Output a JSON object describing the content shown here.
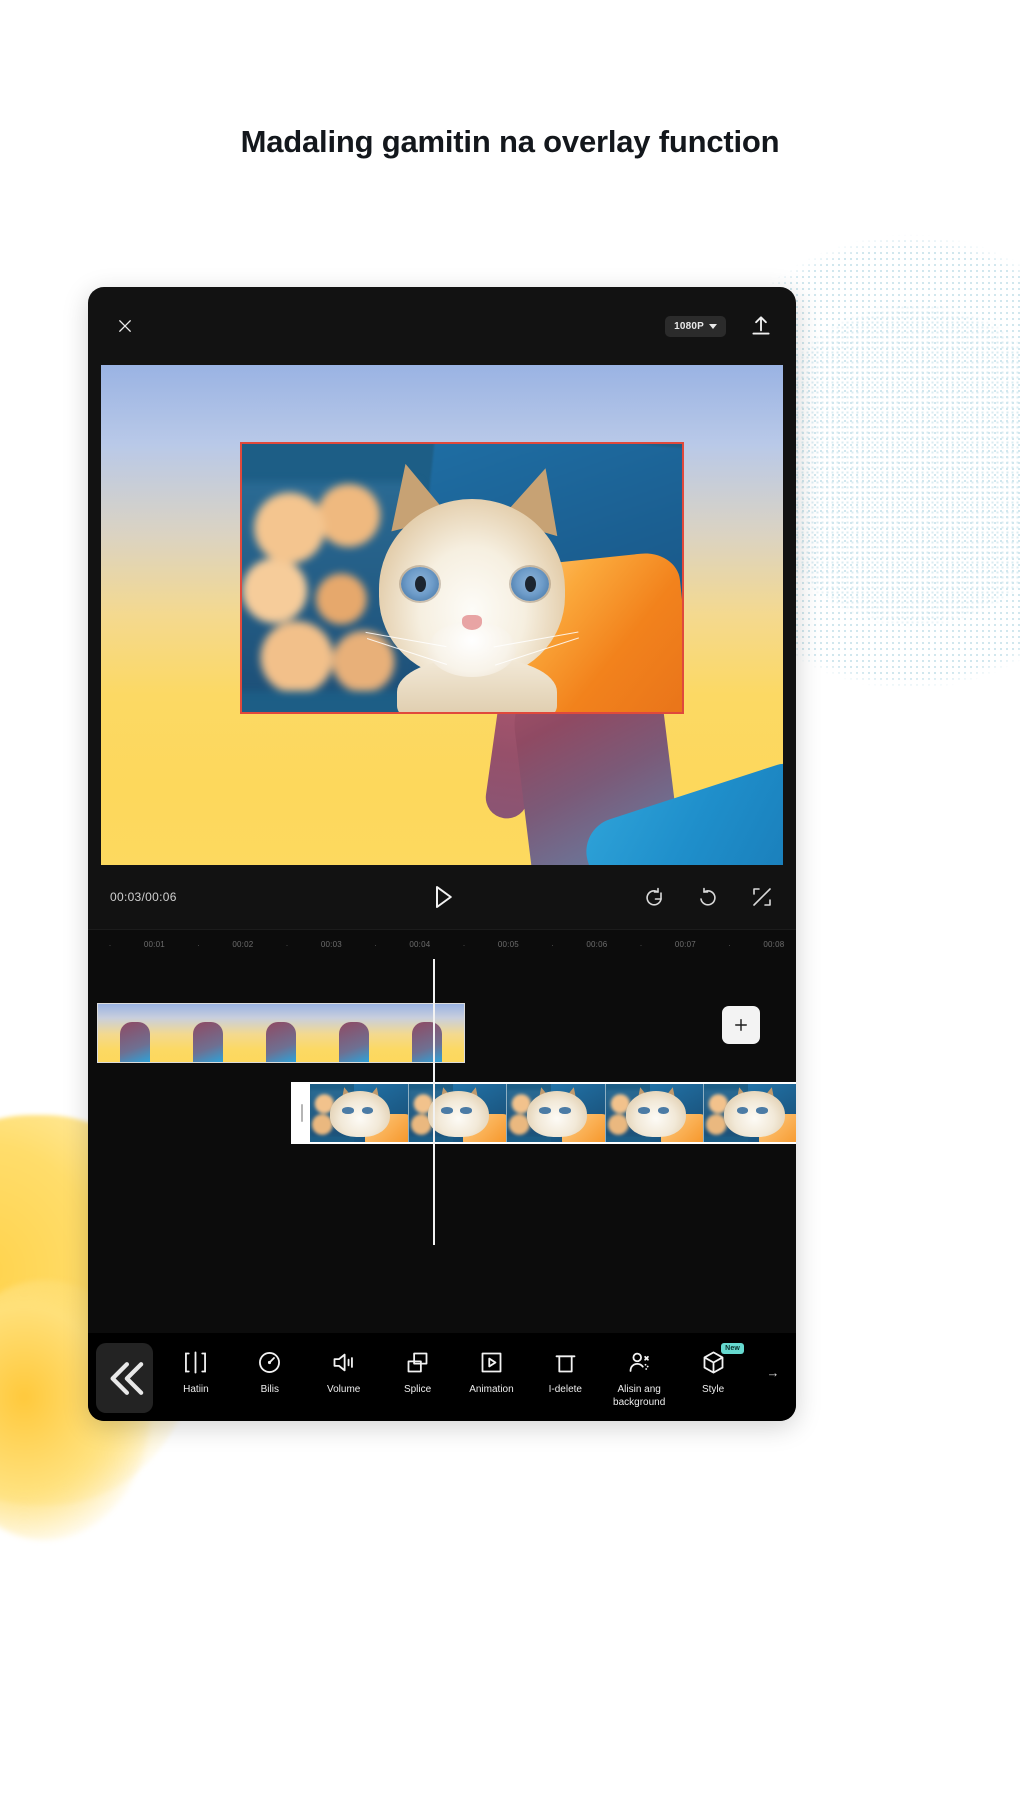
{
  "headline": "Madaling gamitin na overlay function",
  "app": {
    "topbar": {
      "close_icon": "close-icon",
      "resolution": "1080P",
      "export_icon": "export-upload-icon"
    },
    "preview": {
      "overlay_selected": true,
      "selection_color": "#e0493c"
    },
    "playback": {
      "time": "00:03/00:06",
      "current_time": "00:03",
      "total_time": "00:06",
      "play_label": "play-icon",
      "undo_label": "undo-icon",
      "redo_label": "redo-icon",
      "fullscreen_label": "fullscreen-icon"
    },
    "ruler": {
      "marks": [
        "·",
        "00:01",
        "·",
        "00:02",
        "·",
        "00:03",
        "·",
        "00:04",
        "·",
        "00:05",
        "·",
        "00:06",
        "·",
        "00:07",
        "·",
        "00:08"
      ]
    },
    "timeline": {
      "add_button_label": "+",
      "main_track_frames": 5,
      "overlay_track_frames": 5
    },
    "toolbar": {
      "collapse_label": "«",
      "more_label": "→",
      "items": [
        {
          "label": "Hatiin",
          "icon": "split-icon",
          "badge": ""
        },
        {
          "label": "Bilis",
          "icon": "speed-gauge-icon",
          "badge": ""
        },
        {
          "label": "Volume",
          "icon": "volume-icon",
          "badge": ""
        },
        {
          "label": "Splice",
          "icon": "splice-pip-icon",
          "badge": ""
        },
        {
          "label": "Animation",
          "icon": "animation-play-icon",
          "badge": ""
        },
        {
          "label": "I-delete",
          "icon": "trash-delete-icon",
          "badge": ""
        },
        {
          "label": "Alisin ang background",
          "icon": "remove-background-person-icon",
          "badge": ""
        },
        {
          "label": "Style",
          "icon": "style-cube-icon",
          "badge": "New"
        }
      ]
    }
  }
}
